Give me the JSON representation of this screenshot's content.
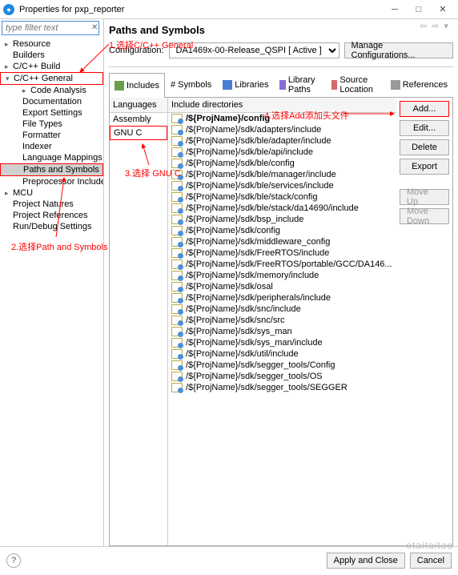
{
  "window": {
    "title": "Properties for pxp_reporter"
  },
  "filter": {
    "placeholder": "type filter text"
  },
  "tree": {
    "resource": "Resource",
    "builders": "Builders",
    "ccbuild": "C/C++ Build",
    "ccgeneral": "C/C++ General",
    "codeanalysis": "Code Analysis",
    "documentation": "Documentation",
    "exportsettings": "Export Settings",
    "filetypes": "File Types",
    "formatter": "Formatter",
    "indexer": "Indexer",
    "langmappings": "Language Mappings",
    "pathssymbols": "Paths and Symbols",
    "preprocinclude": "Preprocessor Include",
    "mcu": "MCU",
    "projnatures": "Project Natures",
    "projrefs": "Project References",
    "rundebug": "Run/Debug Settings"
  },
  "page": {
    "title": "Paths and Symbols"
  },
  "config": {
    "label": "Configuration:",
    "value": "DA1469x-00-Release_QSPI  [ Active ]",
    "manage": "Manage Configurations..."
  },
  "tabs": {
    "includes": "Includes",
    "symbols": "Symbols",
    "libraries": "Libraries",
    "librarypaths": "Library Paths",
    "sourceloc": "Source Location",
    "references": "References",
    "hashprefix": "# "
  },
  "cols": {
    "languages": "Languages",
    "includedirs": "Include directories"
  },
  "languages": {
    "assembly": "Assembly",
    "gnuc": "GNU C"
  },
  "includes": [
    "/${ProjName}/config",
    "/${ProjName}/sdk/adapters/include",
    "/${ProjName}/sdk/ble/adapter/include",
    "/${ProjName}/sdk/ble/api/include",
    "/${ProjName}/sdk/ble/config",
    "/${ProjName}/sdk/ble/manager/include",
    "/${ProjName}/sdk/ble/services/include",
    "/${ProjName}/sdk/ble/stack/config",
    "/${ProjName}/sdk/ble/stack/da14690/include",
    "/${ProjName}/sdk/bsp_include",
    "/${ProjName}/sdk/config",
    "/${ProjName}/sdk/middleware_config",
    "/${ProjName}/sdk/FreeRTOS/include",
    "/${ProjName}/sdk/FreeRTOS/portable/GCC/DA146...",
    "/${ProjName}/sdk/memory/include",
    "/${ProjName}/sdk/osal",
    "/${ProjName}/sdk/peripherals/include",
    "/${ProjName}/sdk/snc/include",
    "/${ProjName}/sdk/snc/src",
    "/${ProjName}/sdk/sys_man",
    "/${ProjName}/sdk/sys_man/include",
    "/${ProjName}/sdk/util/include",
    "/${ProjName}/sdk/segger_tools/Config",
    "/${ProjName}/sdk/segger_tools/OS",
    "/${ProjName}/sdk/segger_tools/SEGGER"
  ],
  "buttons": {
    "add": "Add...",
    "edit": "Edit...",
    "delete": "Delete",
    "export": "Export",
    "moveup": "Move Up",
    "movedown": "Move Down",
    "applyclose": "Apply and Close",
    "cancel": "Cancel"
  },
  "annotations": {
    "a1": "1.选择C/C++ General",
    "a2": "2.选择Path and Symbols",
    "a3": "3.选择 GNU C",
    "a4": "4.选择Add添加头文件"
  },
  "watermark": "otaitaitao"
}
